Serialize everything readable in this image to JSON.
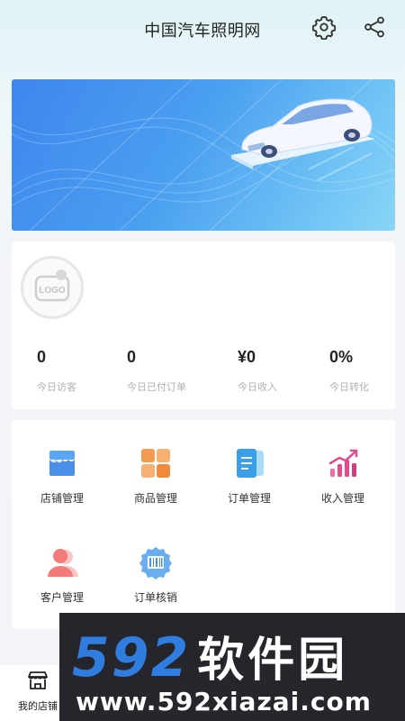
{
  "header": {
    "title": "中国汽车照明网",
    "settings_icon": "gear-icon",
    "share_icon": "share-icon"
  },
  "banner": {
    "image": "car-illustration"
  },
  "shop": {
    "logo_text": "LOGO"
  },
  "stats": [
    {
      "value": "0",
      "label": "今日访客"
    },
    {
      "value": "0",
      "label": "今日已付订单"
    },
    {
      "value": "¥0",
      "label": "今日收入"
    },
    {
      "value": "0%",
      "label": "今日转化"
    }
  ],
  "menu": [
    {
      "label": "店铺管理",
      "icon": "store-icon",
      "color": "#4a90e2"
    },
    {
      "label": "商品管理",
      "icon": "grid-icon",
      "color": "#f39a4e"
    },
    {
      "label": "订单管理",
      "icon": "clipboard-icon",
      "color": "#3a9fe8"
    },
    {
      "label": "收入管理",
      "icon": "bar-chart-icon",
      "color": "#e8488e"
    },
    {
      "label": "客户管理",
      "icon": "user-icon",
      "color": "#f47a7a"
    },
    {
      "label": "订单核销",
      "icon": "ticket-icon",
      "color": "#4a90e2"
    }
  ],
  "tabbar": {
    "items": [
      {
        "label": "我的店铺",
        "icon": "store-tab-icon"
      }
    ]
  },
  "watermark": {
    "brand": "592",
    "brand_cn": "软件园",
    "url": "www.592xiazai.com"
  }
}
